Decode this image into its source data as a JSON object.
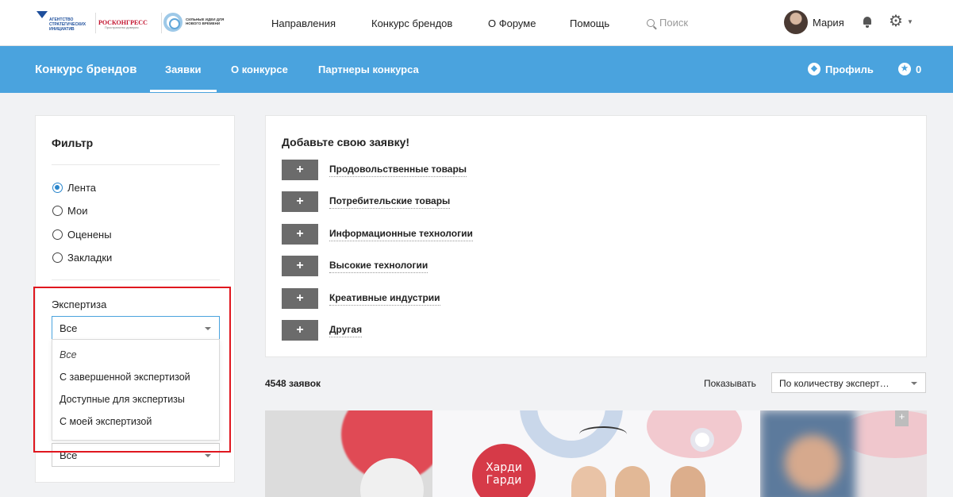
{
  "logos": {
    "asi_text": "АГЕНТСТВО СТРАТЕГИЧЕСКИХ ИНИЦИАТИВ",
    "roscongress": "РОСКОНГРЕСС",
    "roscongress_sub": "Пространство доверия",
    "forum_text": "СИЛЬНЫЕ ИДЕИ ДЛЯ НОВОГО ВРЕМЕНИ"
  },
  "topnav": {
    "items": [
      "Направления",
      "Конкурс брендов",
      "О Форуме",
      "Помощь"
    ],
    "search_placeholder": "Поиск",
    "user_name": "Мария"
  },
  "subnav": {
    "title": "Конкурс брендов",
    "tabs": [
      "Заявки",
      "О конкурсе",
      "Партнеры конкурса"
    ],
    "active_tab": "Заявки",
    "profile_label": "Профиль",
    "star_count": "0"
  },
  "filter": {
    "title": "Фильтр",
    "radios": [
      "Лента",
      "Мои",
      "Оценены",
      "Закладки"
    ],
    "selected_radio": "Лента",
    "expertise_label": "Экспертиза",
    "expertise_value": "Все",
    "expertise_options": [
      "Все",
      "С завершенной экспертизой",
      "Доступные для экспертизы",
      "С моей экспертизой"
    ],
    "second_select_value": "Все"
  },
  "add_card": {
    "title": "Добавьте свою заявку!",
    "plus": "+",
    "categories": [
      "Продовольственные товары",
      "Потребительские товары",
      "Информационные технологии",
      "Высокие технологии",
      "Креативные индустрии",
      "Другая"
    ]
  },
  "results": {
    "count": "4548 заявок",
    "show_label": "Показывать",
    "sort_value": "По количеству эксперт…"
  },
  "images": {
    "brand_logo_text": "Харди Гарди"
  },
  "colors": {
    "primary_blue": "#4aa3de",
    "highlight_red": "#e0171f",
    "plus_button": "#6b6b6b"
  }
}
